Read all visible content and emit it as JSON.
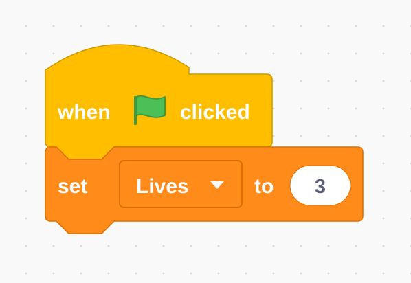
{
  "workspace": {
    "background_color": "#f9f9f9",
    "grid_dot_color": "#d6d8dd"
  },
  "hat_block": {
    "category": "events",
    "color": "#ffbf00",
    "border_color": "#cc9900",
    "label_before_icon": "when",
    "icon": "green-flag-icon",
    "icon_color": "#4cbf56",
    "label_after_icon": "clicked"
  },
  "set_block": {
    "category": "variables",
    "color": "#ff8c1a",
    "border_color": "#db6e00",
    "label_set": "set",
    "variable_dropdown": {
      "selected": "Lives",
      "arrow_icon": "dropdown-arrow-icon"
    },
    "label_to": "to",
    "value_input": "3"
  }
}
